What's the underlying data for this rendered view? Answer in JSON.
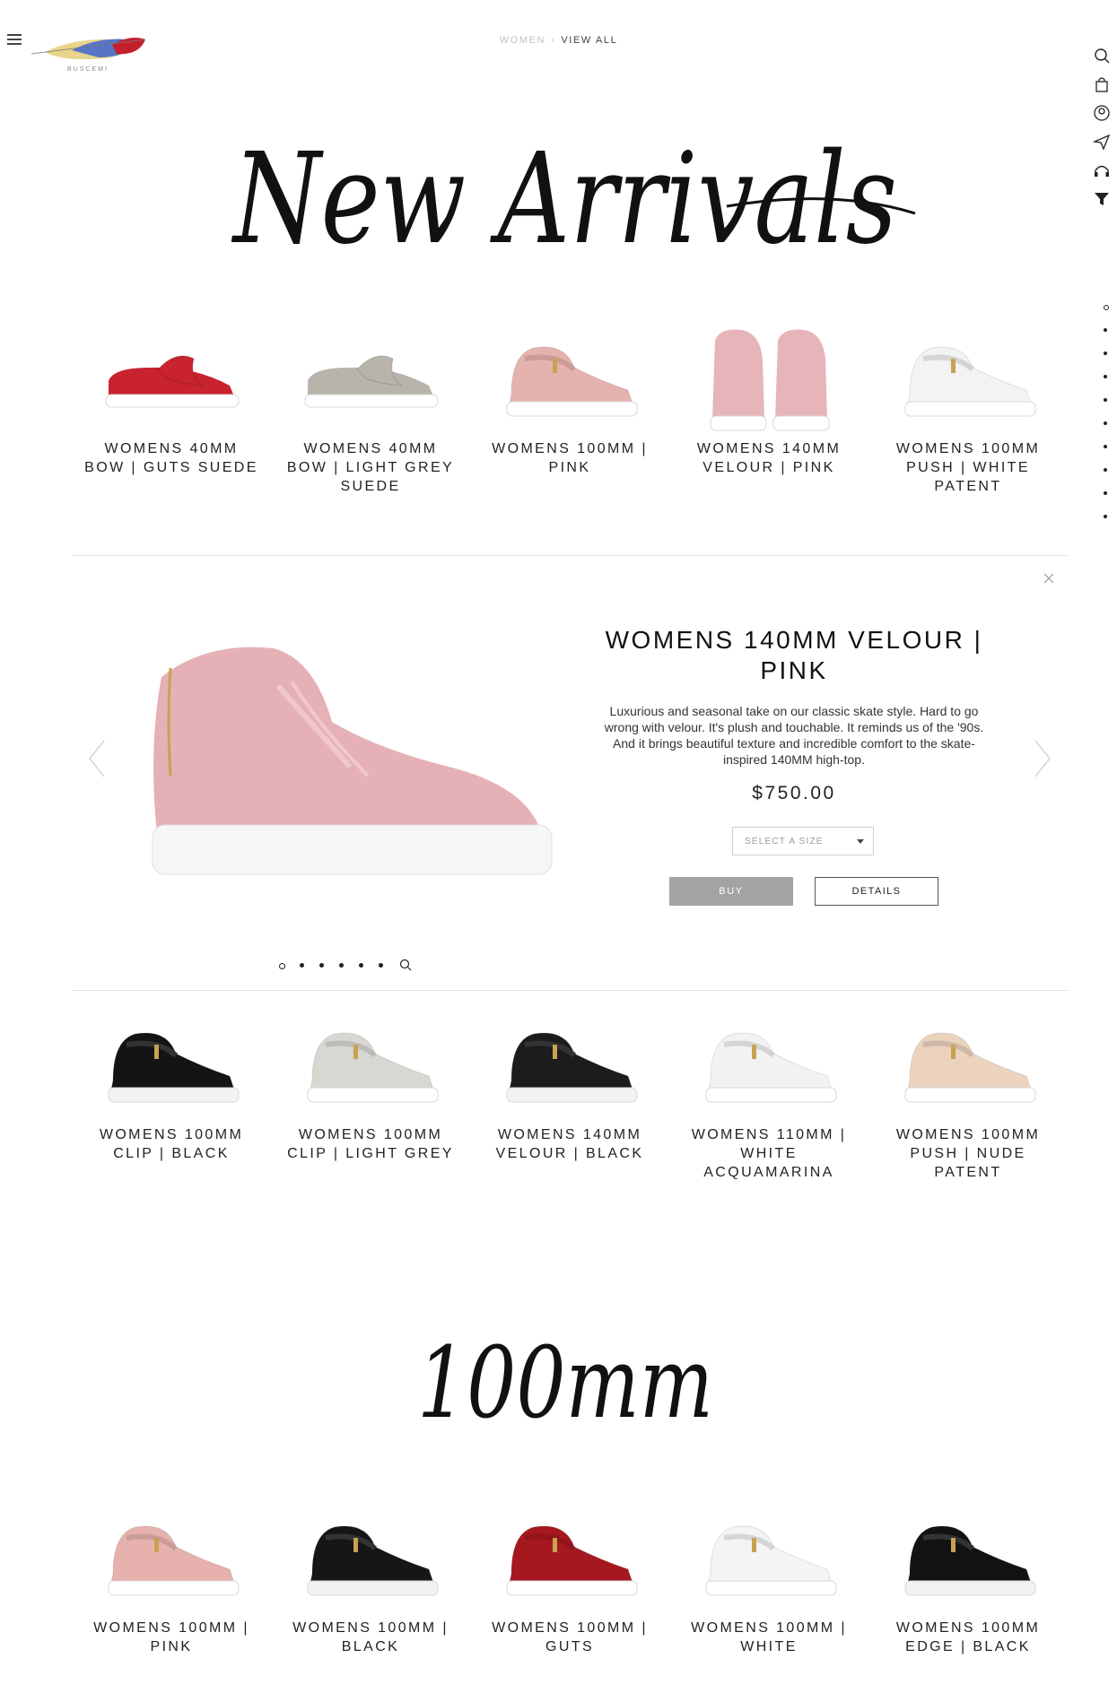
{
  "header": {
    "logo_text": "BUSCEMI",
    "breadcrumb": {
      "link": "WOMEN",
      "separator": "›",
      "current": "VIEW ALL"
    }
  },
  "rail_icons": [
    "search-icon",
    "bag-icon",
    "account-icon",
    "send-icon",
    "headphones-icon",
    "filter-icon"
  ],
  "headline": "New Arrivals",
  "new_arrivals": [
    {
      "name": "WOMENS 40MM BOW | GUTS SUEDE",
      "color": "#c8232e",
      "style": "slipon"
    },
    {
      "name": "WOMENS 40MM BOW | LIGHT GREY SUEDE",
      "color": "#b8b4ab",
      "style": "slipon"
    },
    {
      "name": "WOMENS 100MM | PINK",
      "color": "#e6b2ae",
      "style": "hightop"
    },
    {
      "name": "WOMENS 140MM VELOUR | PINK",
      "color": "#e6b4b9",
      "style": "pair"
    },
    {
      "name": "WOMENS 100MM PUSH | WHITE PATENT",
      "color": "#f3f3f3",
      "style": "hightop"
    }
  ],
  "detail": {
    "title": "WOMENS 140MM VELOUR | PINK",
    "description": "Luxurious and seasonal take on our classic skate style. Hard to go wrong with velour. It's plush and touchable. It reminds us of the '90s. And it brings beautiful texture and incredible comfort to the skate-inspired 140MM high-top.",
    "price": "$750.00",
    "size_placeholder": "SELECT A SIZE",
    "buy_label": "BUY",
    "details_label": "DETAILS",
    "color": "#e5b1b6"
  },
  "more_products": [
    {
      "name": "WOMENS 100MM CLIP | BLACK",
      "color": "#141414",
      "style": "hightop"
    },
    {
      "name": "WOMENS 100MM CLIP | LIGHT GREY",
      "color": "#d8d7d1",
      "style": "hightop"
    },
    {
      "name": "WOMENS 140MM VELOUR | BLACK",
      "color": "#1c1c1c",
      "style": "hightop"
    },
    {
      "name": "WOMENS 110MM | WHITE ACQUAMARINA",
      "color": "#f2f2f2",
      "style": "hightop"
    },
    {
      "name": "WOMENS 100MM PUSH | NUDE PATENT",
      "color": "#ecd3be",
      "style": "hightop"
    }
  ],
  "section_heading": "100mm",
  "section_products": [
    {
      "name": "WOMENS 100MM | PINK",
      "color": "#e7b2ad",
      "style": "hightop"
    },
    {
      "name": "WOMENS 100MM | BLACK",
      "color": "#161616",
      "style": "hightop"
    },
    {
      "name": "WOMENS 100MM | GUTS",
      "color": "#a5181f",
      "style": "hightop"
    },
    {
      "name": "WOMENS 100MM | WHITE",
      "color": "#f4f4f4",
      "style": "hightop"
    },
    {
      "name": "WOMENS 100MM EDGE | BLACK",
      "color": "#121212",
      "style": "hightop"
    }
  ]
}
